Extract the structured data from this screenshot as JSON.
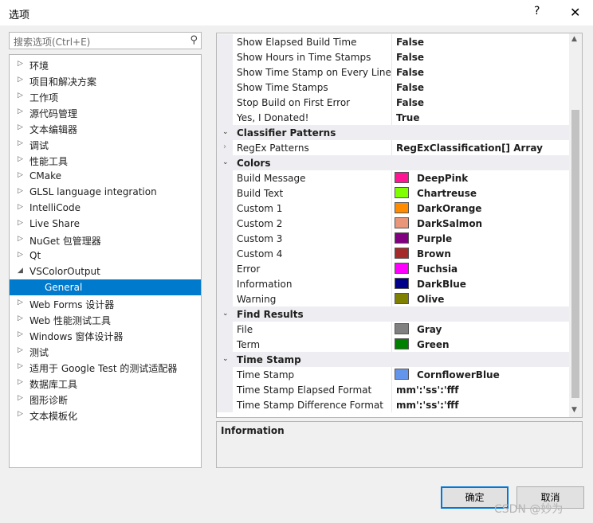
{
  "window": {
    "title": "选项",
    "help": "?",
    "close": "✕"
  },
  "search": {
    "placeholder": "搜索选项(Ctrl+E)"
  },
  "tree": [
    {
      "label": "环境",
      "expander": "▷"
    },
    {
      "label": "项目和解决方案",
      "expander": "▷"
    },
    {
      "label": "工作项",
      "expander": "▷"
    },
    {
      "label": "源代码管理",
      "expander": "▷"
    },
    {
      "label": "文本编辑器",
      "expander": "▷"
    },
    {
      "label": "调试",
      "expander": "▷"
    },
    {
      "label": "性能工具",
      "expander": "▷"
    },
    {
      "label": "CMake",
      "expander": "▷"
    },
    {
      "label": "GLSL language integration",
      "expander": "▷"
    },
    {
      "label": "IntelliCode",
      "expander": "▷"
    },
    {
      "label": "Live Share",
      "expander": "▷"
    },
    {
      "label": "NuGet 包管理器",
      "expander": "▷"
    },
    {
      "label": "Qt",
      "expander": "▷"
    },
    {
      "label": "VSColorOutput",
      "expander": "◢"
    },
    {
      "label": "General",
      "expander": "",
      "child": true,
      "selected": true
    },
    {
      "label": "Web Forms 设计器",
      "expander": "▷"
    },
    {
      "label": "Web 性能测试工具",
      "expander": "▷"
    },
    {
      "label": "Windows 窗体设计器",
      "expander": "▷"
    },
    {
      "label": "测试",
      "expander": "▷"
    },
    {
      "label": "适用于 Google Test 的测试适配器",
      "expander": "▷"
    },
    {
      "label": "数据库工具",
      "expander": "▷"
    },
    {
      "label": "图形诊断",
      "expander": "▷"
    },
    {
      "label": "文本模板化",
      "expander": "▷"
    }
  ],
  "grid": [
    {
      "type": "prop",
      "name": "Show Elapsed Build Time",
      "value": "False"
    },
    {
      "type": "prop",
      "name": "Show Hours in Time Stamps",
      "value": "False"
    },
    {
      "type": "prop",
      "name": "Show Time Stamp on Every Line",
      "value": "False"
    },
    {
      "type": "prop",
      "name": "Show Time Stamps",
      "value": "False"
    },
    {
      "type": "prop",
      "name": "Stop Build on First Error",
      "value": "False"
    },
    {
      "type": "prop",
      "name": "Yes, I Donated!",
      "value": "True"
    },
    {
      "type": "category",
      "name": "Classifier Patterns"
    },
    {
      "type": "prop",
      "name": "RegEx Patterns",
      "value": "RegExClassification[] Array",
      "expandable": true
    },
    {
      "type": "category",
      "name": "Colors"
    },
    {
      "type": "color",
      "name": "Build Message",
      "value": "DeepPink",
      "color": "#FF1493"
    },
    {
      "type": "color",
      "name": "Build Text",
      "value": "Chartreuse",
      "color": "#7FFF00"
    },
    {
      "type": "color",
      "name": "Custom 1",
      "value": "DarkOrange",
      "color": "#FF8C00"
    },
    {
      "type": "color",
      "name": "Custom 2",
      "value": "DarkSalmon",
      "color": "#E9967A"
    },
    {
      "type": "color",
      "name": "Custom 3",
      "value": "Purple",
      "color": "#800080"
    },
    {
      "type": "color",
      "name": "Custom 4",
      "value": "Brown",
      "color": "#A52A2A"
    },
    {
      "type": "color",
      "name": "Error",
      "value": "Fuchsia",
      "color": "#FF00FF"
    },
    {
      "type": "color",
      "name": "Information",
      "value": "DarkBlue",
      "color": "#00008B"
    },
    {
      "type": "color",
      "name": "Warning",
      "value": "Olive",
      "color": "#808000"
    },
    {
      "type": "category",
      "name": "Find Results"
    },
    {
      "type": "color",
      "name": "File",
      "value": "Gray",
      "color": "#808080"
    },
    {
      "type": "color",
      "name": "Term",
      "value": "Green",
      "color": "#008000"
    },
    {
      "type": "category",
      "name": "Time Stamp"
    },
    {
      "type": "color",
      "name": "Time Stamp",
      "value": "CornflowerBlue",
      "color": "#6495ED"
    },
    {
      "type": "prop",
      "name": "Time Stamp  Elapsed Format",
      "value": "mm':'ss':'fff"
    },
    {
      "type": "prop",
      "name": "Time Stamp Difference Format",
      "value": "mm':'ss':'fff"
    }
  ],
  "info": {
    "title": "Information"
  },
  "buttons": {
    "ok": "确定",
    "cancel": "取消"
  },
  "watermark": "CSDN @妙为",
  "colors": {
    "selection": "#007acc",
    "category_bg": "#eeeef2",
    "focus_border": "#0078d7"
  }
}
